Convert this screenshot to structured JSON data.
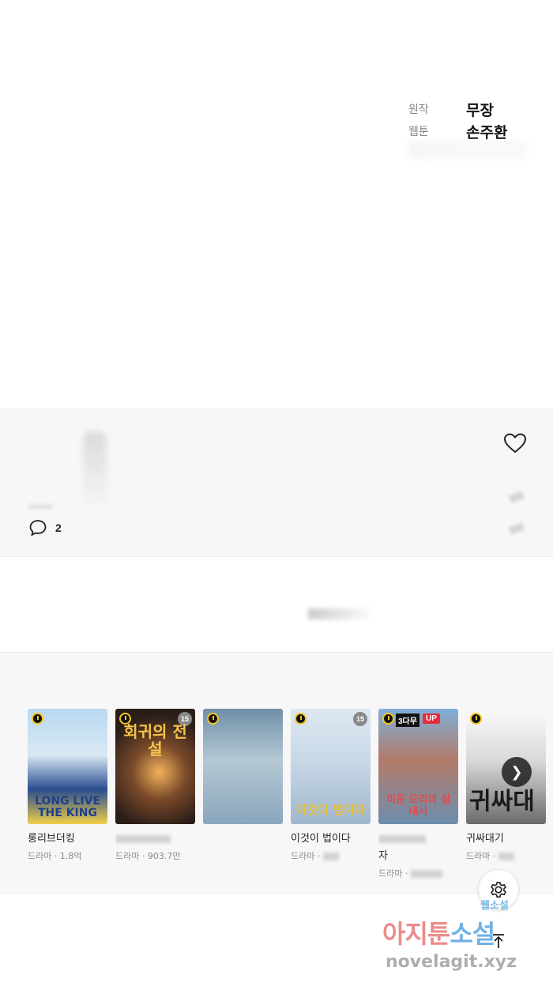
{
  "credits": [
    {
      "label": "원작",
      "name": "무장"
    },
    {
      "label": "웹툰",
      "name": "손주환"
    }
  ],
  "engagement": {
    "comment_count": "2"
  },
  "recommendations": [
    {
      "title": "롱리브더킹",
      "meta": "드라마 · 1.8억",
      "cover_text": "LONG LIVE THE KING",
      "badges": {
        "clock": true
      }
    },
    {
      "title": "",
      "meta": "드라마 · 903.7만",
      "cover_text": "회귀의 전설",
      "badges": {
        "clock": true,
        "age": "15"
      }
    },
    {
      "title": "",
      "meta": "",
      "cover_text": "",
      "badges": {
        "clock": true
      }
    },
    {
      "title": "이것이 법이다",
      "meta": "드라마 · ",
      "cover_text": "이것이 법이다",
      "badges": {
        "clock": true,
        "age": "15"
      }
    },
    {
      "title": "자",
      "meta": "드라마 · ",
      "cover_text": "미운 오리의 실내사",
      "badges": {
        "clock": true,
        "wait": "3다무",
        "up": "UP"
      }
    },
    {
      "title": "귀싸대기",
      "meta": "드라마 · ",
      "cover_text": "귀싸대",
      "badges": {
        "clock": true
      }
    }
  ],
  "watermark": {
    "top": "웹소설",
    "main_red": "아지툰",
    "main_blue": "소설",
    "url": "novelagit.xyz"
  }
}
